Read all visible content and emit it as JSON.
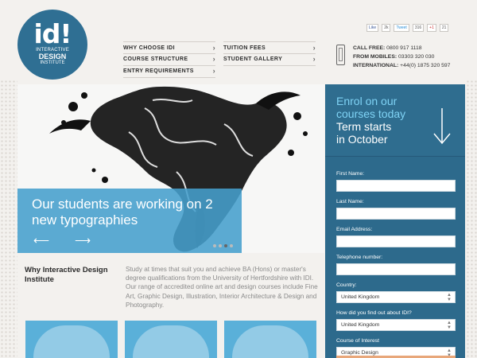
{
  "logo": {
    "mark": "id!",
    "line1": "INTERACTIVE",
    "line2": "DESIGN",
    "line3": "INSTITUTE"
  },
  "social": {
    "like_label": "Like",
    "like_count": "2k",
    "tweet_label": "Tweet",
    "tweet_count": "316",
    "gplus_label": "+1",
    "gplus_count": "21"
  },
  "nav": {
    "items": [
      {
        "label": "WHY CHOOSE IDI"
      },
      {
        "label": "COURSE STRUCTURE"
      },
      {
        "label": "ENTRY REQUIREMENTS"
      },
      {
        "label": "TUITION FEES"
      },
      {
        "label": "STUDENT GALLERY"
      }
    ]
  },
  "contact": {
    "call_free_label": "CALL FREE:",
    "call_free_value": "0800 917 1118",
    "mobiles_label": "FROM MOBILES:",
    "mobiles_value": "03303 320 030",
    "international_label": "INTERNATIONAL:",
    "international_value": "+44(0) 1875 320 597"
  },
  "hero": {
    "title": "Our students are working on 2 new typographies",
    "arrows": "⟵ ⟶"
  },
  "why": {
    "title": "Why Interactive Design Institute",
    "text": "Study at times that suit you and achieve BA (Hons) or master's degree qualifications from the University of Hertfordshire with IDI. Our range of accredited online art and design courses include Fine Art, Graphic Design, Illustration, Interior Architecture & Design and Photography."
  },
  "enrol": {
    "line1a": "Enrol on our",
    "line1b": "courses today",
    "line2a": "Term starts",
    "line2b": "in October"
  },
  "form": {
    "first_name_label": "First Name:",
    "last_name_label": "Last Name:",
    "email_label": "Email Address:",
    "telephone_label": "Telephone number:",
    "country_label": "Country:",
    "country_value": "United Kingdom",
    "heard_label": "How did you find out about IDI?",
    "heard_value": "United Kingdom",
    "course_label": "Course of Interest",
    "course_value": "Graphic Design"
  },
  "colors": {
    "brand_blue": "#2f6f93",
    "hero_blue": "#459fcd",
    "enrol_bg": "#2d6a8c",
    "enrol_accent": "#7fd3f5"
  }
}
